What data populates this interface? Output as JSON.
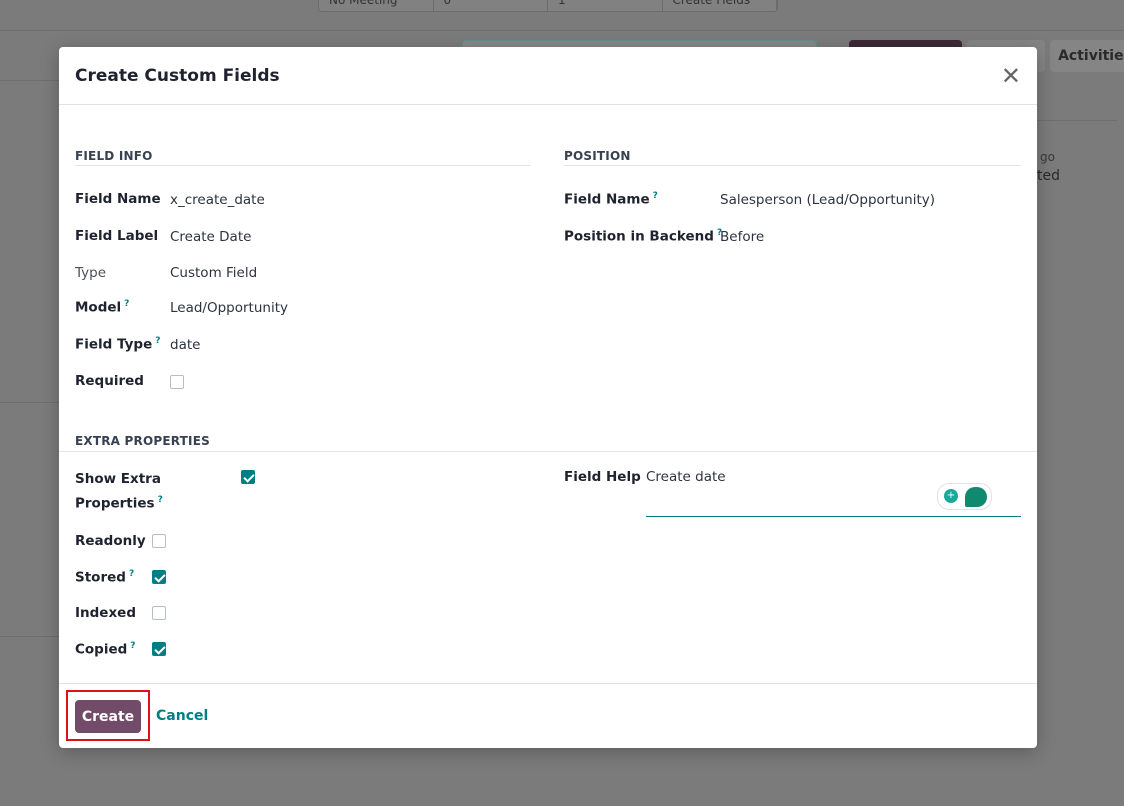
{
  "background": {
    "topbar": [
      "No Meeting",
      "0",
      "1",
      "Create Fields"
    ],
    "activities_label": "Activities",
    "right_texts": [
      "go",
      "ted"
    ]
  },
  "modal": {
    "title": "Create Custom Fields",
    "field_info": {
      "heading": "FIELD INFO",
      "field_name_label": "Field Name",
      "field_name": "x_create_date",
      "field_label_label": "Field Label",
      "field_label": "Create Date",
      "type_label": "Type",
      "type": "Custom Field",
      "model_label": "Model",
      "model": "Lead/Opportunity",
      "field_type_label": "Field Type",
      "field_type": "date",
      "required_label": "Required",
      "required": false
    },
    "position": {
      "heading": "POSITION",
      "field_name_label": "Field Name",
      "field_name": "Salesperson (Lead/Opportunity)",
      "backend_label": "Position in Backend",
      "backend": "Before"
    },
    "extra": {
      "heading": "EXTRA PROPERTIES",
      "show_extra_label": "Show Extra Properties",
      "show_extra": true,
      "readonly_label": "Readonly",
      "readonly": false,
      "stored_label": "Stored",
      "stored": true,
      "indexed_label": "Indexed",
      "indexed": false,
      "copied_label": "Copied",
      "copied": true,
      "field_help_label": "Field Help",
      "field_help": "Create date"
    },
    "tooltip_mark": "?",
    "create_label": "Create",
    "cancel_label": "Cancel",
    "accent": "#017e84",
    "primary": "#714b67"
  }
}
